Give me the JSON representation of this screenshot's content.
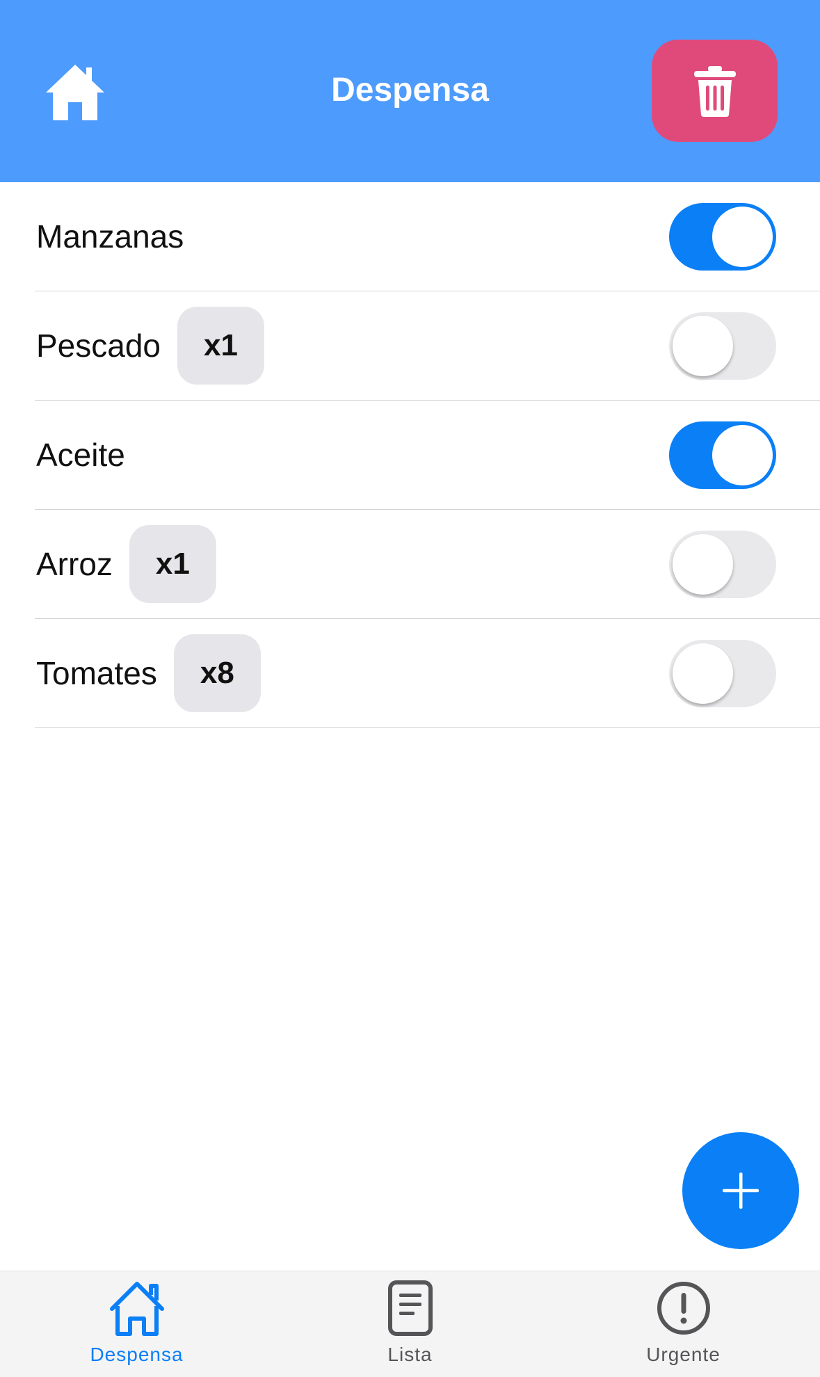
{
  "header": {
    "title": "Despensa",
    "home_icon": "home-icon",
    "delete_icon": "trash-icon",
    "background": "#4d9bfc",
    "delete_color": "#e04a7b"
  },
  "items": [
    {
      "name": "Manzanas",
      "quantity": null,
      "enabled": true
    },
    {
      "name": "Pescado",
      "quantity": "x1",
      "enabled": false
    },
    {
      "name": "Aceite",
      "quantity": null,
      "enabled": true
    },
    {
      "name": "Arroz",
      "quantity": "x1",
      "enabled": false
    },
    {
      "name": "Tomates",
      "quantity": "x8",
      "enabled": false
    }
  ],
  "fab": {
    "icon": "plus-icon",
    "color": "#0a7ff6"
  },
  "tabs": [
    {
      "label": "Despensa",
      "icon": "home-icon",
      "active": true
    },
    {
      "label": "Lista",
      "icon": "document-icon",
      "active": false
    },
    {
      "label": "Urgente",
      "icon": "alert-circle-icon",
      "active": false
    }
  ],
  "colors": {
    "accent": "#0a7ff6",
    "toggle_off": "#e9e9ec",
    "badge": "#e6e6ea"
  }
}
